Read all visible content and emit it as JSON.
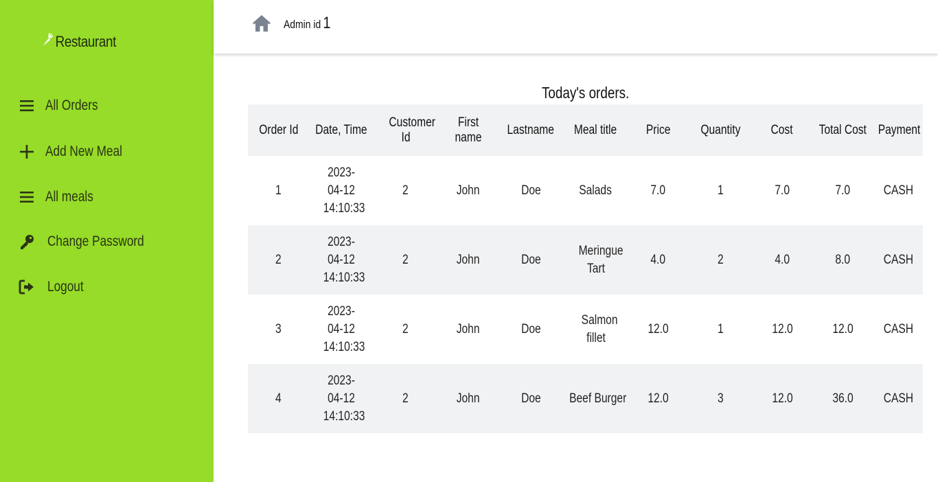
{
  "colors": {
    "brand": "#96dc28",
    "nav_text": "#2a3414",
    "home_icon": "#7b8391"
  },
  "sidebar": {
    "brand": "Restaurant",
    "brand_icon": "carrot-icon",
    "items": [
      {
        "label": "All Orders",
        "icon": "bars-icon"
      },
      {
        "label": "Add New Meal",
        "icon": "plus-icon"
      },
      {
        "label": "All meals",
        "icon": "bars-icon"
      },
      {
        "label": "Change Password",
        "icon": "key-icon"
      },
      {
        "label": "Logout",
        "icon": "sign-out-icon"
      }
    ]
  },
  "header": {
    "home_icon": "home-icon",
    "admin_label": "Admin id",
    "admin_id": "1"
  },
  "main": {
    "title": "Today's orders.",
    "columns": [
      "Order Id",
      "Date, Time",
      "Customer Id",
      "First name",
      "Lastname",
      "Meal title",
      "Price",
      "Quantity",
      "Cost",
      "Total Cost",
      "Payment"
    ],
    "rows": [
      [
        "1",
        "2023-04-12 14:10:33",
        "2",
        "John",
        "Doe",
        "Salads",
        "7.0",
        "1",
        "7.0",
        "7.0",
        "CASH"
      ],
      [
        "2",
        "2023-04-12 14:10:33",
        "2",
        "John",
        "Doe",
        "Meringue Tart",
        "4.0",
        "2",
        "4.0",
        "8.0",
        "CASH"
      ],
      [
        "3",
        "2023-04-12 14:10:33",
        "2",
        "John",
        "Doe",
        "Salmon fillet",
        "12.0",
        "1",
        "12.0",
        "12.0",
        "CASH"
      ],
      [
        "4",
        "2023-04-12 14:10:33",
        "2",
        "John",
        "Doe",
        "Beef Burger",
        "12.0",
        "3",
        "12.0",
        "36.0",
        "CASH"
      ]
    ]
  }
}
